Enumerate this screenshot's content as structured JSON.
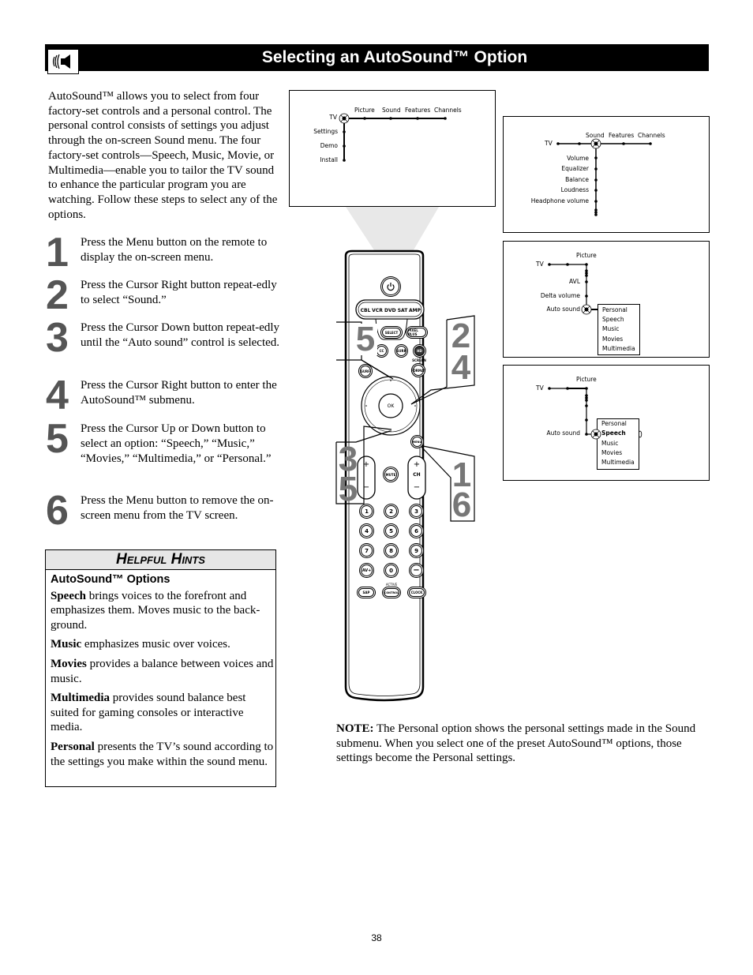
{
  "header": {
    "title": "Selecting an AutoSound™ Option",
    "icon": "speaker-sound-icon"
  },
  "intro": "AutoSound™ allows you to select from four factory-set controls and a personal control. The personal control consists of settings you adjust through the on-screen Sound menu. The four factory-set controls—Speech, Music, Movie, or Multimedia—enable you to tailor the TV sound to enhance the particular program you are watching. Follow these steps to select any of the options.",
  "steps": [
    {
      "num": "1",
      "text": "Press the Menu button on the remote to display the on-screen menu."
    },
    {
      "num": "2",
      "text": "Press the Cursor Right button repeat-edly to select “Sound.”"
    },
    {
      "num": "3",
      "text": "Press the Cursor Down button repeat-edly until the “Auto sound” control is selected."
    },
    {
      "num": "4",
      "text": "Press the Cursor Right button to enter the AutoSound™ submenu."
    },
    {
      "num": "5",
      "text": "Press the Cursor Up or Down button to select an option: “Speech,” “Music,” “Movies,” “Multimedia,” or “Personal.”"
    },
    {
      "num": "6",
      "text": "Press the Menu button to remove the on-screen menu from the TV screen."
    }
  ],
  "hints": {
    "title": "Helpful Hints",
    "subtitle": "AutoSound™ Options",
    "items": [
      {
        "term": "Speech",
        "text": " brings voices to the forefront and emphasizes them. Moves music to the back-ground."
      },
      {
        "term": "Music",
        "text": " emphasizes music over voices."
      },
      {
        "term": "Movies",
        "text": " provides a balance between voices and music."
      },
      {
        "term": "Multimedia",
        "text": " provides sound balance best suited for gaming consoles or interactive media."
      },
      {
        "term": "Personal",
        "text": " presents the TV’s sound according to the settings you make within the sound menu."
      }
    ]
  },
  "menus": {
    "main": {
      "root": "TV",
      "top": [
        "Picture",
        "Sound",
        "Features",
        "Channels"
      ],
      "side": [
        "Settings",
        "Demo",
        "Install"
      ]
    },
    "sound": {
      "root": "TV",
      "top": [
        "Sound",
        "Features",
        "Channels"
      ],
      "side": [
        "Volume",
        "Equalizer",
        "Balance",
        "Loudness",
        "Headphone  volume"
      ]
    },
    "autosound": {
      "root": "TV",
      "top": "Picture",
      "side": [
        "AVL",
        "Delta  volume",
        "Auto  sound"
      ],
      "options": [
        "Personal",
        "Speech",
        "Music",
        "Movies",
        "Multimedia"
      ]
    },
    "autosound_select": {
      "root": "TV",
      "top": "Picture",
      "side": "Auto  sound",
      "options": [
        "Personal",
        "Speech",
        "Music",
        "Movies",
        "Multimedia"
      ]
    }
  },
  "remote": {
    "source_buttons": [
      "CBL",
      "VCR",
      "DVD",
      "SAT",
      "AMP"
    ],
    "buttons": {
      "select": "SELECT",
      "pixel_plus": "PIXEL PLUS",
      "cc": "CC",
      "surr": "SURR",
      "hd": "HD",
      "screen_label": "SCREEN",
      "surf": "SURF",
      "format": "FORMAT",
      "ok": "OK",
      "menu": "MENU",
      "mute": "MUTE",
      "ch": "CH",
      "plus": "+",
      "minus": "−",
      "digits": [
        "1",
        "2",
        "3",
        "4",
        "5",
        "6",
        "7",
        "8",
        "9"
      ],
      "av": "AV+",
      "zero": "0",
      "dash": "−",
      "sap": "SAP",
      "active_label": "ACTIVE",
      "control": "CONTROL",
      "clock": "CLOCK"
    },
    "callouts": {
      "left_top": "5",
      "right_top": [
        "2",
        "4"
      ],
      "left_bottom": [
        "3",
        "5"
      ],
      "right_bottom": [
        "1",
        "6"
      ]
    }
  },
  "note": {
    "label": "NOTE:",
    "text": " The Personal option shows the personal settings made in the Sound submenu. When you select one of the preset AutoSound™ options, those settings become the Personal settings."
  },
  "page_number": "38"
}
